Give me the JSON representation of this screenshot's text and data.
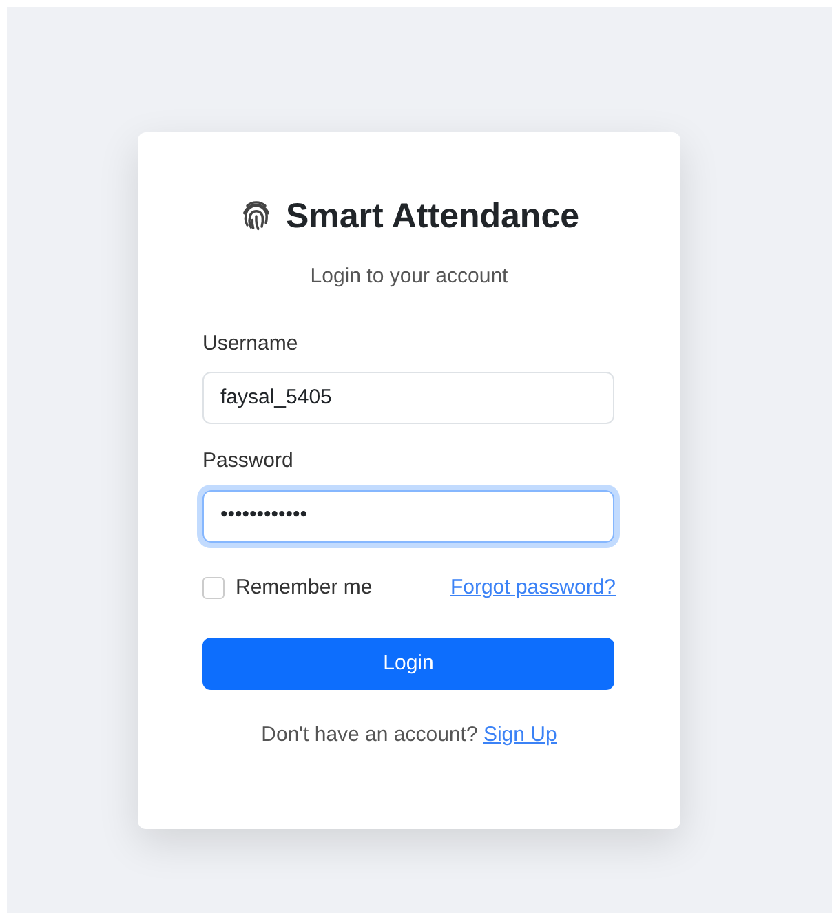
{
  "title": "Smart Attendance",
  "subtitle": "Login to your account",
  "fields": [
    {
      "label": "Username",
      "value": "faysal_5405",
      "focused": false
    },
    {
      "label": "Password",
      "value": "••••••••••••",
      "focused": true
    }
  ],
  "remember": {
    "label": "Remember me",
    "checked": false
  },
  "forgot_link": "Forgot password?",
  "login_button": "Login",
  "signup": {
    "text": "Don't have an account?",
    "link": "Sign Up"
  }
}
